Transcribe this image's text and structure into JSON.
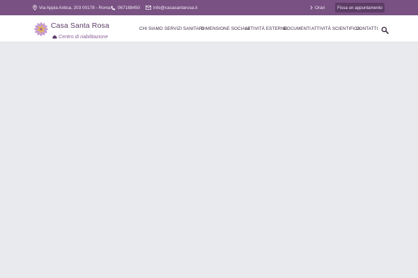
{
  "topbar": {
    "address": "Via Appia Antica, 203 00178 - Roma",
    "phone": "067188450",
    "email": "info@casasantarosa.it",
    "hours_label": "Orari",
    "appointment_label": "Fissa un appuntamento",
    "icons": [
      "map-pin-icon",
      "phone-icon",
      "mail-icon",
      "chevron-right-icon"
    ]
  },
  "header": {
    "logo": {
      "title": "Casa Santa Rosa",
      "subtitle": "Centro di riabilitazione"
    },
    "nav": [
      {
        "label": "CHI SIAMO"
      },
      {
        "label": "SERVIZI SANITARI"
      },
      {
        "label": "DIMENSIONE SOCIALE"
      },
      {
        "label": "ATTIVITÀ ESTERNE"
      },
      {
        "label": "DOCUMENTI"
      },
      {
        "label": "ATTIVITÀ SCIENTIFICA"
      },
      {
        "label": "CONTATTI"
      }
    ],
    "search_icon": "search-icon"
  },
  "colors": {
    "topbar_bg": "#795283",
    "button_bg": "#5e3c68",
    "header_bg": "#ffffff",
    "content_bg": "#e8eaee",
    "brand_text": "#5c3a66"
  }
}
